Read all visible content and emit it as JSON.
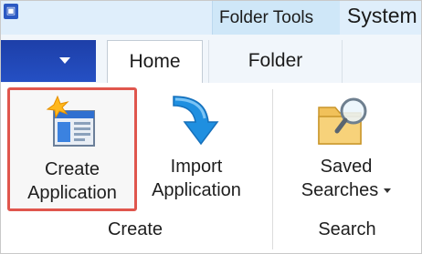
{
  "titlebar": {
    "app_icon": "app-icon",
    "context_tab": "Folder Tools",
    "window_title": "System"
  },
  "tabs": [
    {
      "label": "Home",
      "selected": true
    },
    {
      "label": "Folder",
      "selected": false
    }
  ],
  "file_menu": {
    "icon": "caret-down-icon"
  },
  "ribbon": {
    "groups": [
      {
        "label": "Create",
        "buttons": [
          {
            "line1": "Create",
            "line2": "Application",
            "icon": "create-application-icon",
            "highlighted": true,
            "highlight_color": "#e0564d"
          },
          {
            "line1": "Import",
            "line2": "Application",
            "icon": "import-arrow-icon"
          }
        ]
      },
      {
        "label": "Search",
        "buttons": [
          {
            "line1": "Saved",
            "line2": "Searches",
            "icon": "saved-searches-icon",
            "has_dropdown": true
          }
        ]
      }
    ]
  },
  "colors": {
    "file_tab": "#2550c4",
    "highlight": "#e0564d",
    "context_tab_bg": "#cfe7f8"
  }
}
